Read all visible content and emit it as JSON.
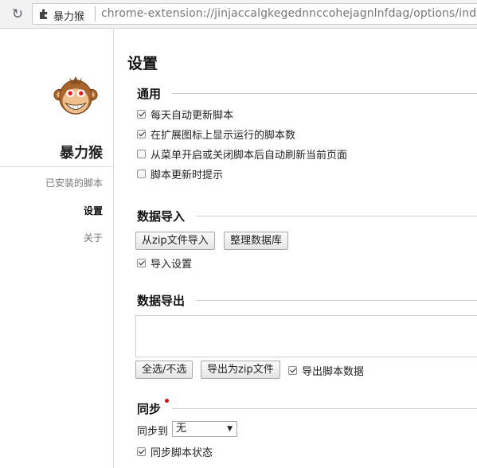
{
  "browser": {
    "reload_icon": "reload-icon",
    "extension_name": "暴力猴",
    "url": "chrome-extension://jinjaccalgkegednnccohejagnlnfdag/options/index.ht"
  },
  "sidebar": {
    "app_name": "暴力猴",
    "logo": "monkey-logo",
    "items": [
      {
        "label": "已安装的脚本",
        "active": false
      },
      {
        "label": "设置",
        "active": true
      },
      {
        "label": "关于",
        "active": false
      }
    ]
  },
  "main": {
    "title": "设置",
    "general": {
      "heading": "通用",
      "options": [
        {
          "label": "每天自动更新脚本",
          "checked": true
        },
        {
          "label": "在扩展图标上显示运行的脚本数",
          "checked": true
        },
        {
          "label": "从菜单开启或关闭脚本后自动刷新当前页面",
          "checked": false
        },
        {
          "label": "脚本更新时提示",
          "checked": false
        }
      ]
    },
    "import": {
      "heading": "数据导入",
      "import_zip_button": "从zip文件导入",
      "vacuum_button": "整理数据库",
      "import_settings": {
        "label": "导入设置",
        "checked": true
      }
    },
    "export": {
      "heading": "数据导出",
      "select_all_button": "全选/不选",
      "export_zip_button": "导出为zip文件",
      "export_values": {
        "label": "导出脚本数据",
        "checked": true
      }
    },
    "sync": {
      "heading": "同步",
      "sync_to_label": "同步到",
      "sync_to_value": "无",
      "sync_state": {
        "label": "同步脚本状态",
        "checked": true
      }
    }
  },
  "colors": {
    "notification_dot": "#e00000",
    "sidebar_border": "#d8d8d8"
  }
}
